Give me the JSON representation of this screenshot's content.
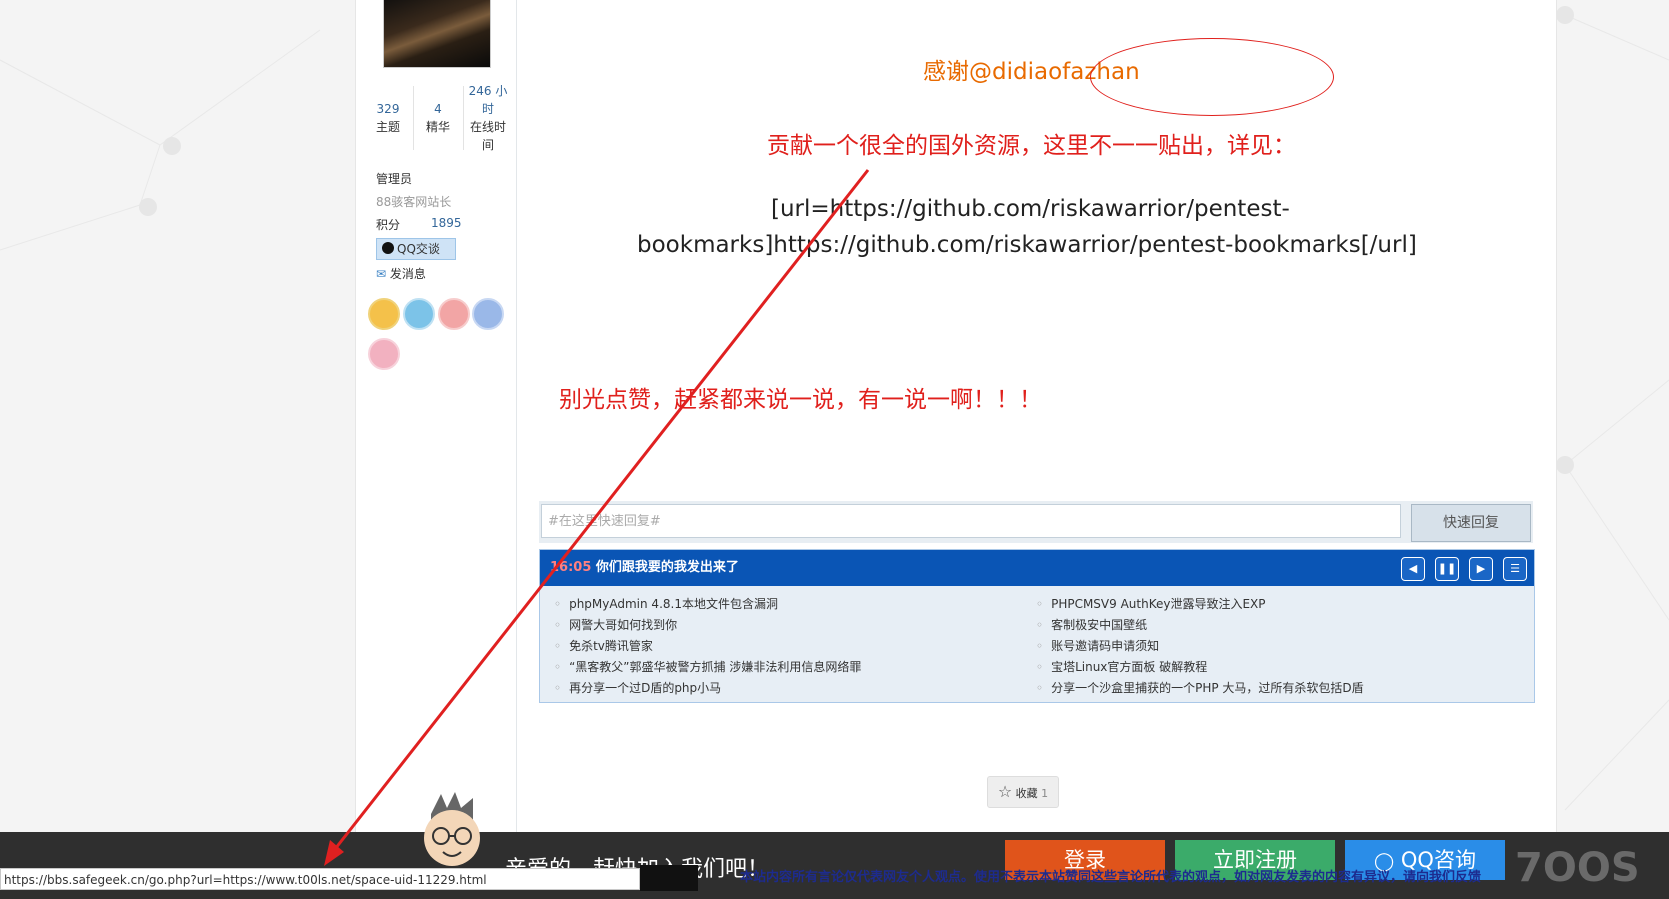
{
  "sidebar": {
    "stats": [
      {
        "num": "329",
        "label": "主题"
      },
      {
        "num": "4",
        "label": "精华"
      },
      {
        "num": "246 小时",
        "label": "在线时间"
      }
    ],
    "role": "管理员",
    "title": "88骇客网站长",
    "points_label": "积分",
    "points_value": "1895",
    "qq_btn": "QQ交谈",
    "message_link": "发消息"
  },
  "post": {
    "thanks": "感谢@didiaofazhan",
    "contribute": "贡献一个很全的国外资源，这里不一一贴出，详见：",
    "url_line1": "[url=https://github.com/riskawarrior/pentest-",
    "url_line2": "bookmarks]https://github.com/riskawarrior/pentest-bookmarks[/url]",
    "call_to_action": "别光点赞，赶紧都来说一说，有一说一啊！！！"
  },
  "reply": {
    "placeholder": "#在这里快速回复#",
    "button": "快速回复"
  },
  "news": {
    "time": "16:05",
    "headline": "你们跟我要的我发出来了",
    "left": [
      "phpMyAdmin 4.8.1本地文件包含漏洞",
      "网警大哥如何找到你",
      "免杀tv腾讯管家",
      "“黑客教父”郭盛华被警方抓捕 涉嫌非法利用信息网络罪",
      "再分享一个过D盾的php小马"
    ],
    "right": [
      "PHPCMSV9 AuthKey泄露导致注入EXP",
      "客制极安中国壁纸",
      "账号邀请码申请须知",
      "宝塔Linux官方面板 破解教程",
      "分享一个沙盒里捕获的一个PHP 大马，过所有杀软包括D盾"
    ]
  },
  "favorite": {
    "label": "收藏",
    "count": "1"
  },
  "footer": {
    "join_text": "亲爱的，赶快加入我们吧！",
    "login": "登录",
    "register": "立即注册",
    "qq_consult": "QQ咨询",
    "notice": "本站内容所有言论仅代表网友个人观点。使用不表示本站赞同这些言论所代表的观点，如对网友发表的内容有异议，请向我们反馈",
    "logo": "7OOS"
  },
  "status_url": "https://bbs.safegeek.cn/go.php?url=https://www.t00ls.net/space-uid-11229.html",
  "colors": {
    "accent_red": "#e0201c",
    "news_blue": "#0a55b5",
    "login_orange": "#e0541b",
    "register_green": "#3bab6a",
    "qq_blue": "#2a8de8"
  }
}
